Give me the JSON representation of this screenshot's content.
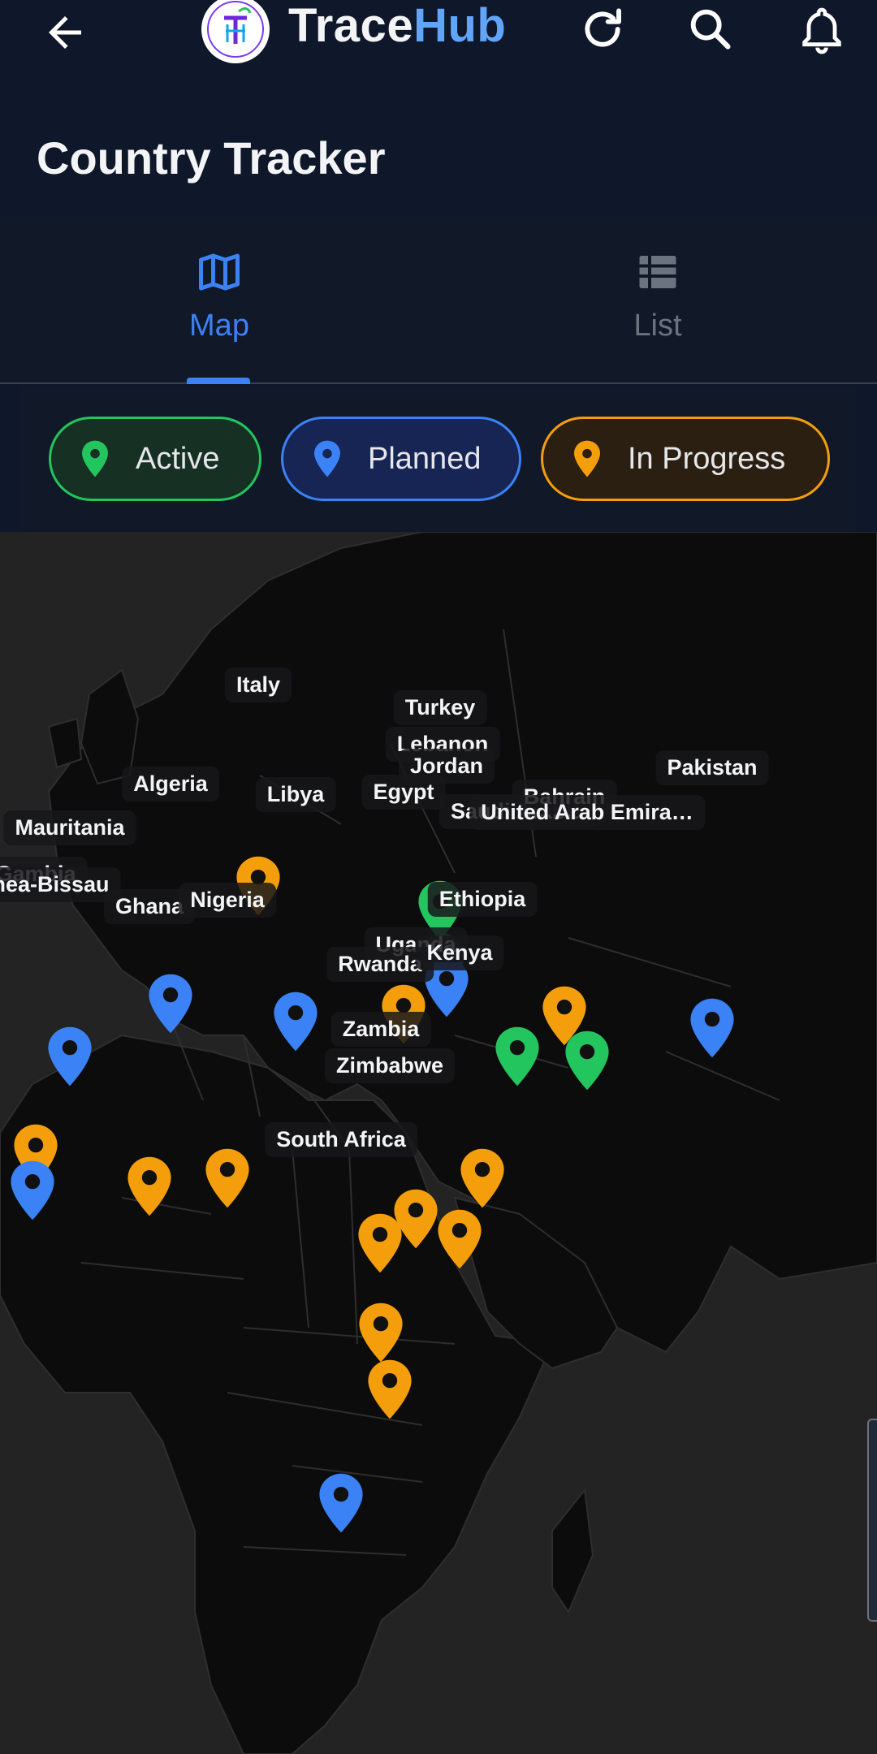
{
  "app": {
    "brand_part1": "Trace",
    "brand_part2": "Hub",
    "logo_text": "TH"
  },
  "page": {
    "title": "Country Tracker"
  },
  "tabs": [
    {
      "label": "Map",
      "icon": "map-icon",
      "selected": true
    },
    {
      "label": "List",
      "icon": "list-icon",
      "selected": false
    }
  ],
  "filters": [
    {
      "label": "Active",
      "color": "#22c55e"
    },
    {
      "label": "Planned",
      "color": "#3b82f6"
    },
    {
      "label": "In Progress",
      "color": "#f59e0b"
    }
  ],
  "colors": {
    "active": "#22c55e",
    "planned": "#3b82f6",
    "in_progress": "#f59e0b",
    "accent": "#3b82f6"
  },
  "map": {
    "markers": [
      {
        "label": "Italy",
        "status": "in_progress"
      },
      {
        "label": "Turkey",
        "status": "active"
      },
      {
        "label": "Lebanon",
        "status": "active"
      },
      {
        "label": "Jordan",
        "status": "planned"
      },
      {
        "label": "Egypt",
        "status": "in_progress"
      },
      {
        "label": "Algeria",
        "status": "planned"
      },
      {
        "label": "Libya",
        "status": "planned"
      },
      {
        "label": "Mauritania",
        "status": "planned"
      },
      {
        "label": "Pakistan",
        "status": "planned"
      },
      {
        "label": "Saudi Arabia",
        "status": "active"
      },
      {
        "label": "Bahrain",
        "status": "in_progress"
      },
      {
        "label": "United Arab Emira…",
        "status": "active"
      },
      {
        "label": "Gambia",
        "status": "in_progress"
      },
      {
        "label": "Guinea-Bissau",
        "status": "planned"
      },
      {
        "label": "Ghana",
        "status": "in_progress"
      },
      {
        "label": "Nigeria",
        "status": "in_progress"
      },
      {
        "label": "Ethiopia",
        "status": "in_progress"
      },
      {
        "label": "Uganda",
        "status": "in_progress"
      },
      {
        "label": "Rwanda",
        "status": "in_progress"
      },
      {
        "label": "Kenya",
        "status": "in_progress"
      },
      {
        "label": "Zambia",
        "status": "in_progress"
      },
      {
        "label": "Zimbabwe",
        "status": "in_progress"
      },
      {
        "label": "South Africa",
        "status": "planned"
      }
    ]
  }
}
